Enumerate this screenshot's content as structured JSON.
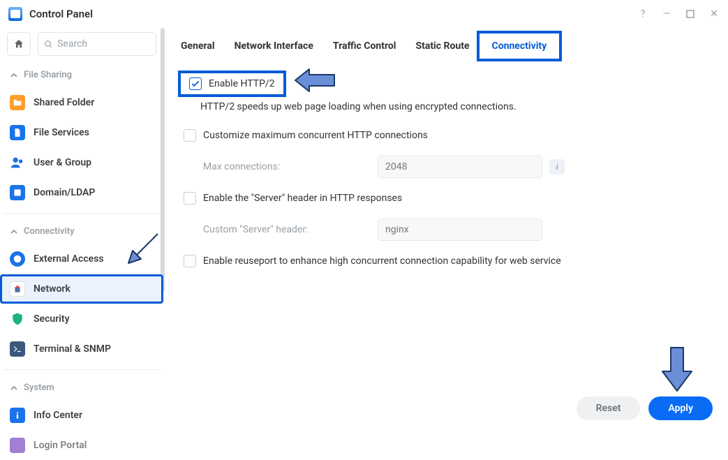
{
  "window": {
    "title": "Control Panel"
  },
  "search": {
    "placeholder": "Search"
  },
  "sections": {
    "file_sharing": "File Sharing",
    "connectivity": "Connectivity",
    "system": "System"
  },
  "sidebar": {
    "shared_folder": "Shared Folder",
    "file_services": "File Services",
    "user_group": "User & Group",
    "domain_ldap": "Domain/LDAP",
    "external_access": "External Access",
    "network": "Network",
    "security": "Security",
    "terminal_snmp": "Terminal & SNMP",
    "info_center": "Info Center",
    "login_portal": "Login Portal"
  },
  "tabs": {
    "general": "General",
    "network_interface": "Network Interface",
    "traffic_control": "Traffic Control",
    "static_route": "Static Route",
    "connectivity": "Connectivity"
  },
  "options": {
    "enable_http2": "Enable HTTP/2",
    "http2_help": "HTTP/2 speeds up web page loading when using encrypted connections.",
    "customize_conc": "Customize maximum concurrent HTTP connections",
    "max_conn_label": "Max connections:",
    "max_conn_value": "2048",
    "server_header": "Enable the \"Server\" header in HTTP responses",
    "custom_server_label": "Custom \"Server\" header:",
    "custom_server_value": "nginx",
    "reuseport": "Enable reuseport to enhance high concurrent connection capability for web service"
  },
  "buttons": {
    "reset": "Reset",
    "apply": "Apply"
  }
}
